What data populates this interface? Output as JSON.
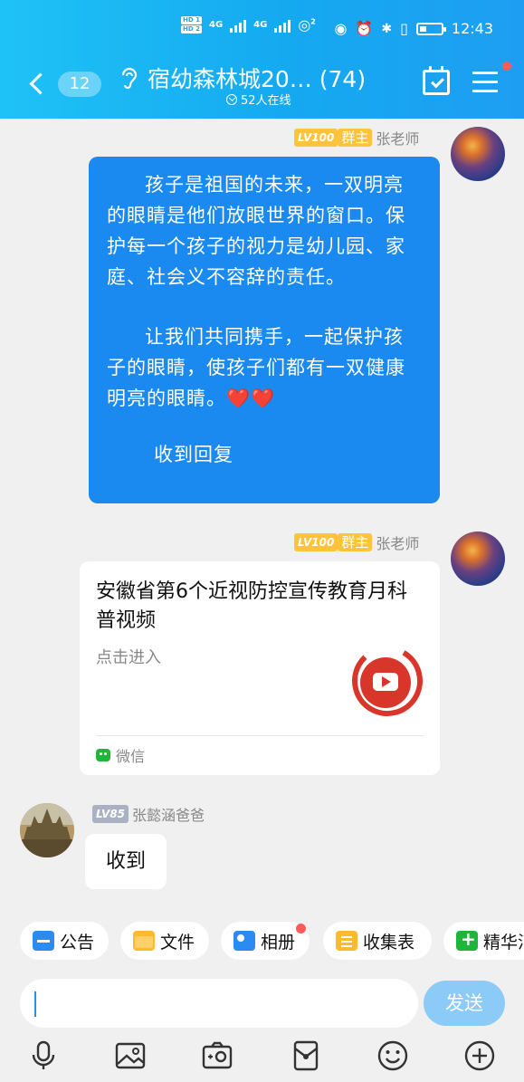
{
  "status_bar": {
    "hd1": "HD 1",
    "hd2": "HD 2",
    "net1": "4G",
    "net2": "4G",
    "hotspot": "2",
    "time": "12:43"
  },
  "header": {
    "unread_count": "12",
    "title": "宿幼森林城20… (74)",
    "online": "52人在线"
  },
  "messages": [
    {
      "level": "LV100",
      "role": "群主",
      "sender": "张老师",
      "para1": "孩子是祖国的未来，一双明亮的眼睛是他们放眼世界的窗口。保护每一个孩子的视力是幼儿园、家庭、社会义不容辞的责任。",
      "para2": "让我们共同携手，一起保护孩子的眼睛，使孩子们都有一双健康明亮的眼睛。❤️❤️",
      "reply": "收到回复"
    },
    {
      "level": "LV100",
      "role": "群主",
      "sender": "张老师",
      "card_title": "安徽省第6个近视防控宣传教育月科普视频",
      "card_desc": "点击进入",
      "card_source": "微信"
    },
    {
      "level": "LV85",
      "sender": "张懿涵爸爸",
      "text": "收到"
    }
  ],
  "shortcuts": [
    {
      "label": "公告",
      "icon": "notice-icon"
    },
    {
      "label": "文件",
      "icon": "folder-icon"
    },
    {
      "label": "相册",
      "icon": "album-icon"
    },
    {
      "label": "收集表",
      "icon": "form-icon"
    },
    {
      "label": "精华消息",
      "icon": "essence-icon"
    }
  ],
  "input": {
    "placeholder": "",
    "send_label": "发送"
  },
  "toolbar": [
    "microphone-icon",
    "image-icon",
    "camera-icon",
    "red-packet-icon",
    "emoji-icon",
    "plus-icon"
  ],
  "colors": {
    "header": "#15a9f0",
    "bubble": "#1b8af0",
    "badge": "#ffc33b",
    "send": "#8ccaf7"
  }
}
